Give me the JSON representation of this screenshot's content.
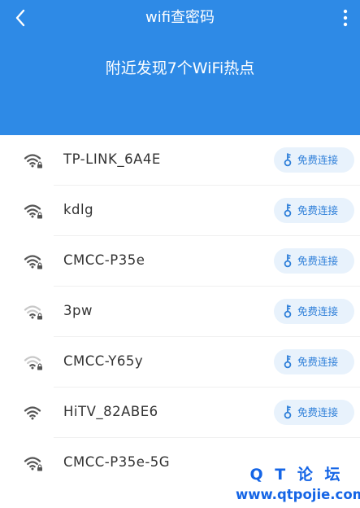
{
  "app": {
    "title": "wifi查密码",
    "accent_color": "#2e8ae6",
    "back_icon": "chevron-left-icon",
    "more_icon": "more-vertical-icon"
  },
  "summary": "附近发现7个WiFi热点",
  "connect_label": "免费连接",
  "networks": [
    {
      "ssid": "TP-LINK_6A4E",
      "signal": "strong",
      "locked": true
    },
    {
      "ssid": "kdlg",
      "signal": "strong",
      "locked": true
    },
    {
      "ssid": "CMCC-P35e",
      "signal": "strong",
      "locked": true
    },
    {
      "ssid": "3pw",
      "signal": "weak",
      "locked": true
    },
    {
      "ssid": "CMCC-Y65y",
      "signal": "weak",
      "locked": true
    },
    {
      "ssid": "HiTV_82ABE6",
      "signal": "strong",
      "locked": false
    },
    {
      "ssid": "CMCC-P35e-5G",
      "signal": "strong",
      "locked": true
    }
  ],
  "watermark": {
    "line1": "Q T 论 坛",
    "line2": "www.qtpojie.com"
  }
}
